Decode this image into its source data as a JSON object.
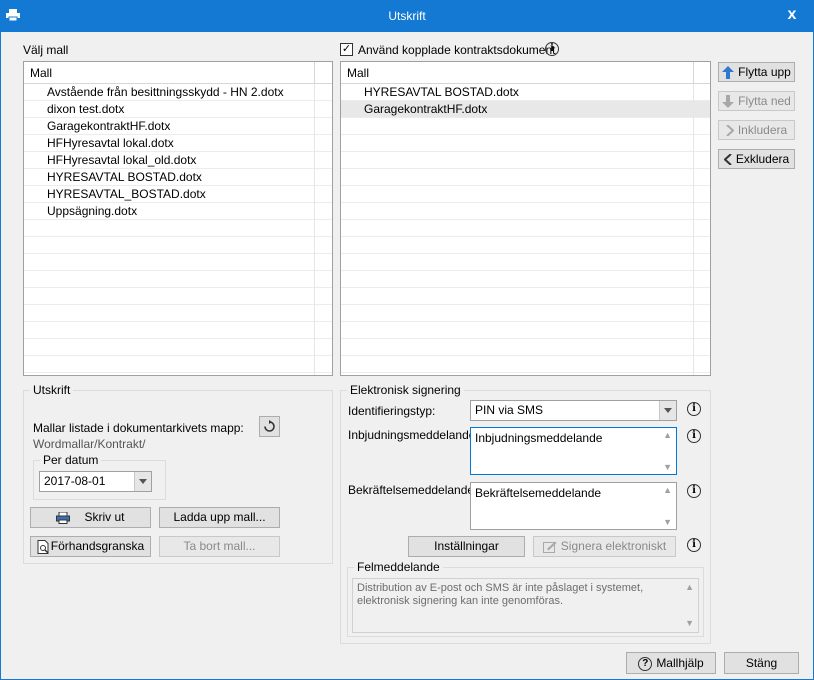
{
  "window": {
    "title": "Utskrift",
    "close_glyph": "x"
  },
  "left": {
    "section_label": "Välj mall",
    "column_header": "Mall",
    "items": [
      "Avstående från besittningsskydd - HN 2.dotx",
      "dixon test.dotx",
      "GaragekontraktHF.dotx",
      "HFHyresavtal lokal.dotx",
      "HFHyresavtal lokal_old.dotx",
      "HYRESAVTAL BOSTAD.dotx",
      "HYRESAVTAL_BOSTAD.dotx",
      "Uppsägning.dotx"
    ]
  },
  "right": {
    "checkbox_label": "Använd kopplade kontraktsdokument",
    "checkbox_checked": true,
    "column_header": "Mall",
    "items": [
      "HYRESAVTAL BOSTAD.dotx",
      "GaragekontraktHF.dotx"
    ],
    "selected_index": 1
  },
  "side_buttons": {
    "move_up": "Flytta upp",
    "move_down": "Flytta ned",
    "include": "Inkludera",
    "exclude": "Exkludera"
  },
  "print_group": {
    "title": "Utskrift",
    "folder_label": "Mallar listade i dokumentarkivets mapp:",
    "folder_path": "Wordmallar/Kontrakt/",
    "date_group_title": "Per datum",
    "date_value": "2017-08-01",
    "print_button": "Skriv ut",
    "upload_button": "Ladda upp mall...",
    "preview_button": "Förhandsgranska",
    "delete_button": "Ta bort mall..."
  },
  "esign_group": {
    "title": "Elektronisk signering",
    "id_type_label": "Identifieringstyp:",
    "id_type_value": "PIN via SMS",
    "invite_label": "Inbjudningsmeddelande:",
    "invite_value": "Inbjudningsmeddelande",
    "confirm_label": "Bekräftelsemeddelande:",
    "confirm_value": "Bekräftelsemeddelande",
    "settings_button": "Inställningar",
    "sign_button": "Signera elektroniskt",
    "error_group_title": "Felmeddelande",
    "error_text": "Distribution av E-post och SMS är inte påslaget i systemet, elektronisk signering kan inte genomföras."
  },
  "footer": {
    "help_button": "Mallhjälp",
    "close_button": "Stäng"
  },
  "colors": {
    "titlebar": "#1379d3",
    "window_bg": "#f0f0f0",
    "arrow_up_blue": "#2f78d0",
    "focus_border": "#0078d7"
  },
  "icons": {
    "info": "ⓘ",
    "check": "✓",
    "refresh": "refresh-icon",
    "printer": "printer-icon",
    "preview": "preview-icon",
    "help": "?"
  }
}
